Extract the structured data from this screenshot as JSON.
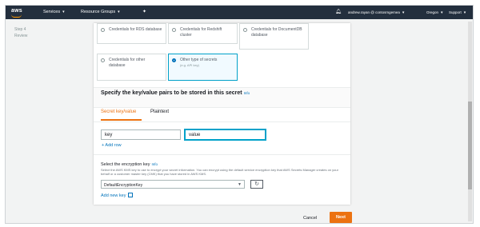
{
  "navbar": {
    "logo": "aws",
    "services": "Services",
    "resource_groups": "Resource Groups",
    "user": "andrew.rayan @ contosmgemea",
    "region": "Oregon",
    "support": "Support"
  },
  "steps": [
    "Step 4",
    "Review"
  ],
  "secret_types": [
    {
      "label": "Credentials for RDS database",
      "selected": false
    },
    {
      "label": "Credentials for Redshift cluster",
      "selected": false
    },
    {
      "label": "Credentials for DocumentDB database",
      "selected": false
    },
    {
      "label": "Credentials for other database",
      "selected": false
    },
    {
      "label": "Other type of secrets",
      "sublabel": "(e.g. API key)",
      "selected": true
    }
  ],
  "kv_section": {
    "title": "Specify the key/value pairs to be stored in this secret",
    "info": "Info",
    "tabs": [
      "Secret key/value",
      "Plaintext"
    ],
    "key_value": "key",
    "value_value": "value",
    "add_row": "+ Add row"
  },
  "encryption": {
    "title": "Select the encryption key",
    "info": "Info",
    "description": "Select the AWS KMS key to use to encrypt your secret information. You can encrypt using the default service encryption key that AWS Secrets Manager creates on your behalf or a customer master key (CMK) that you have stored in AWS KMS.",
    "selected_key": "DefaultEncryptionKey",
    "add_new_key": "Add new key"
  },
  "footer": {
    "cancel": "Cancel",
    "next": "Next"
  },
  "colors": {
    "nav_bg": "#232f3e",
    "accent": "#ec7211",
    "link": "#0073bb",
    "selected_card_bg": "#f1faff"
  }
}
